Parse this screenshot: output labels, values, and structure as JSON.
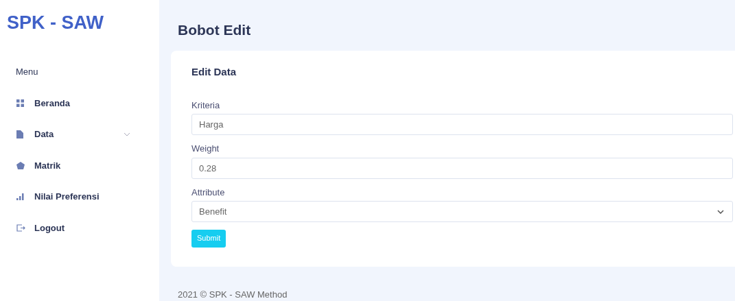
{
  "brand": "SPK - SAW",
  "sidebar": {
    "heading": "Menu",
    "items": [
      {
        "label": "Beranda",
        "kind": "grid",
        "expandable": false
      },
      {
        "label": "Data",
        "kind": "file",
        "expandable": true
      },
      {
        "label": "Matrik",
        "kind": "pentagon",
        "expandable": false
      },
      {
        "label": "Nilai Preferensi",
        "kind": "bars",
        "expandable": false
      },
      {
        "label": "Logout",
        "kind": "logout",
        "expandable": false
      }
    ]
  },
  "page_title": "Bobot Edit",
  "card": {
    "title": "Edit Data",
    "fields": [
      {
        "label": "Kriteria",
        "kind": "text",
        "value": "Harga"
      },
      {
        "label": "Weight",
        "kind": "text",
        "value": "0.28"
      },
      {
        "label": "Attribute",
        "kind": "select",
        "value": "Benefit"
      }
    ],
    "submit": "Submit"
  },
  "footer": "2021 © SPK - SAW Method"
}
